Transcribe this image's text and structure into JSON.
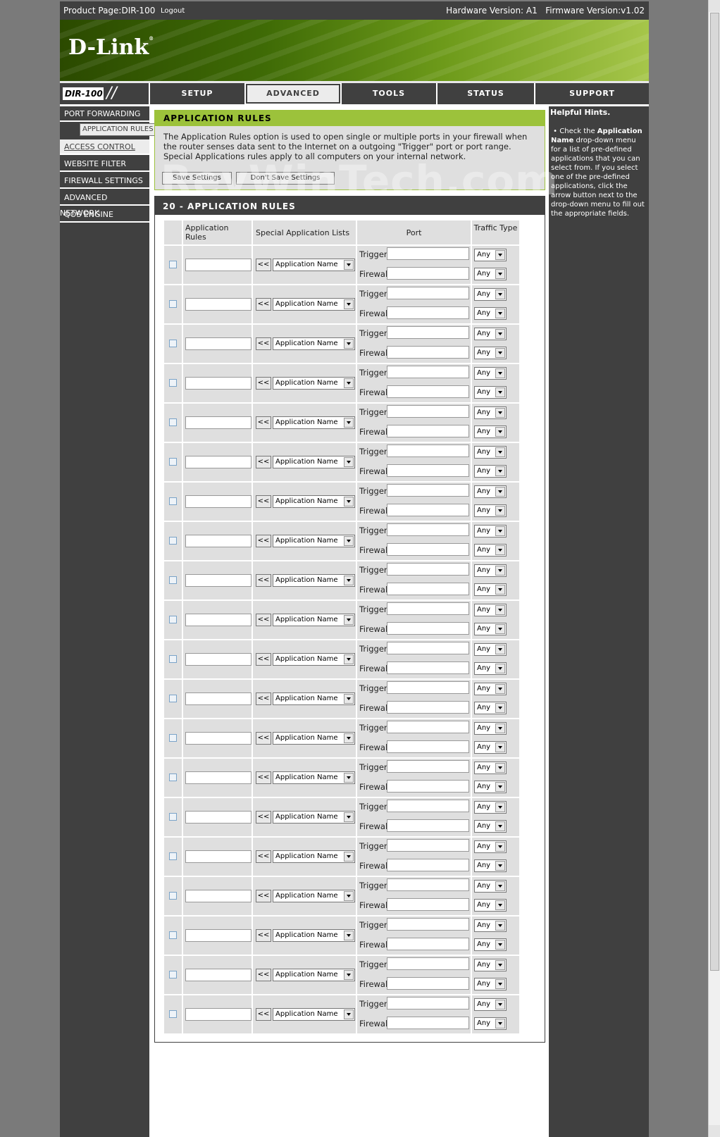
{
  "topbar": {
    "product": "Product Page:DIR-100",
    "logout": "Logout",
    "versions": "Hardware Version: A1   Firmware Version:v1.02"
  },
  "brand": {
    "logo": "D-Link",
    "model": "DIR-100"
  },
  "tabs": [
    "SETUP",
    "ADVANCED",
    "TOOLS",
    "STATUS",
    "SUPPORT"
  ],
  "active_tab": "ADVANCED",
  "leftnav": [
    "PORT FORWARDING",
    "APPLICATION RULES",
    "ACCESS CONTROL",
    "WEBSITE FILTER",
    "FIREWALL SETTINGS",
    "ADVANCED NETWORK",
    "QOS ENGINE"
  ],
  "hints": {
    "title": "Helpful Hints.",
    "pre": "Check the ",
    "bold": "Application Name",
    "post": " drop-down menu for a list of pre-defined applications that you can select from. If you select one of the pre-defined applications, click the arrow button next to the drop-down menu to fill out the appropriate fields."
  },
  "app_rules": {
    "title": "APPLICATION RULES",
    "description": "The Application Rules option is used to open single or multiple ports in your firewall when the router senses data sent to the Internet on a outgoing \"Trigger\" port or port range. Special Applications rules apply to all computers on your internal network.",
    "save": "Save Settings",
    "dont_save": "Don't Save Settings"
  },
  "rules_table": {
    "title": "20 - APPLICATION RULES",
    "headers": {
      "rules": "Application Rules",
      "special": "Special Application Lists",
      "port": "Port",
      "traffic": "Traffic Type"
    },
    "row_count": 20,
    "arrow_label": "<<",
    "app_name_option": "Application Name",
    "trigger_label": "Trigger",
    "firewall_label": "Firewall",
    "traffic_value": "Any"
  },
  "watermark": "RevWinTech.com",
  "colors": {
    "header_dark": "#404040",
    "accent_green": "#9cc23b",
    "panel_grey": "#dfdfdf"
  }
}
